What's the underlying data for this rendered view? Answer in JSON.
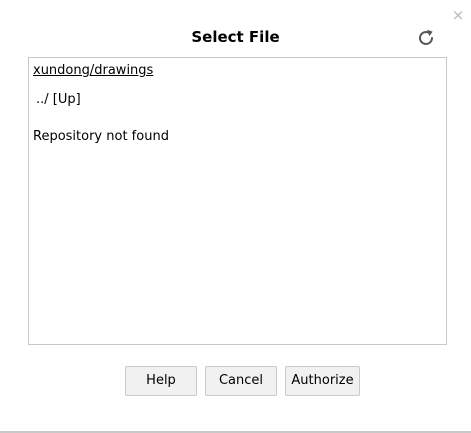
{
  "dialog": {
    "title": "Select File",
    "close_glyph": "×",
    "icons": {
      "close": "close-icon",
      "refresh": "refresh-icon"
    },
    "colors": {
      "refresh_icon": "#555555",
      "close_icon": "#b9b9b9",
      "border": "#c8c8c8",
      "button_bg": "#f1f1f1"
    }
  },
  "file_browser": {
    "path": "xundong/drawings",
    "up_label": "../ [Up]",
    "message": "Repository not found"
  },
  "buttons": {
    "help": "Help",
    "cancel": "Cancel",
    "authorize": "Authorize"
  }
}
